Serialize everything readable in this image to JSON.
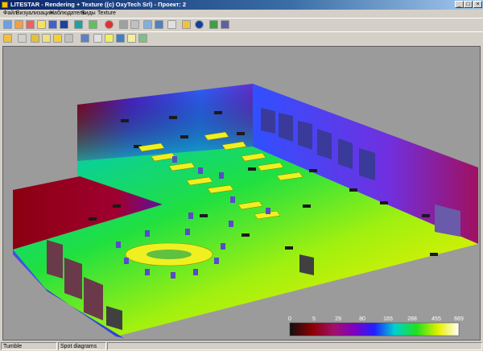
{
  "window": {
    "title": "LITESTAR - Rendering + Texture ((c) OxyTech Srl) - Проект: 2"
  },
  "menu": [
    "Файл",
    "Визуализация",
    "Наблюдатель",
    "Виды",
    "Texture"
  ],
  "toolbar1": [
    "new-icon",
    "open-icon",
    "save-icon",
    "print-icon",
    "cube-icon",
    "cube-solid-icon",
    "layers-icon",
    "palette-icon",
    "lamp-icon",
    "grid-icon",
    "lines-icon",
    "face-icon",
    "edge-icon",
    "chart-icon",
    "axis-icon",
    "info-icon",
    "network-icon",
    "export-icon"
  ],
  "toolbar2": [
    "move-icon",
    "pointer-icon",
    "rotate-icon",
    "sun-icon",
    "pencil-icon",
    "zoom-icon",
    "orbit-icon",
    "spot-icon",
    "light-icon",
    "scene-icon",
    "explode-icon",
    "fly-icon"
  ],
  "legend": {
    "ticks": [
      "0",
      "5",
      "29",
      "80",
      "165",
      "288",
      "455",
      "669"
    ],
    "colors": [
      "#101010",
      "#8b0000",
      "#a0106a",
      "#8000c0",
      "#2020ff",
      "#00d0d0",
      "#20e020",
      "#e8f000",
      "#ffffff"
    ]
  },
  "status": {
    "mode": "Tumble",
    "view": "Spot diagrams"
  },
  "colors": {
    "title_start": "#0a246a",
    "viewport_bg": "#9b9b9b"
  }
}
